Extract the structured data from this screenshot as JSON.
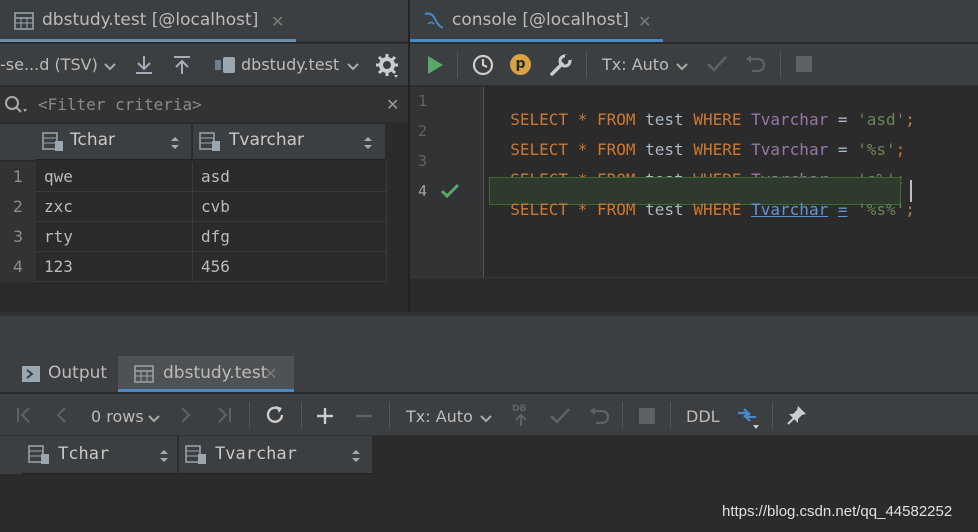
{
  "left_tab": {
    "title": "dbstudy.test [@localhost]",
    "close": "✕"
  },
  "right_tab": {
    "title": "console [@localhost]",
    "close": "✕"
  },
  "left_toolbar": {
    "export_format": "-se...d (TSV)",
    "datasource": "dbstudy.test"
  },
  "filter": {
    "placeholder": "<Filter criteria>",
    "clear": "✕"
  },
  "grid": {
    "columns": [
      "Tchar",
      "Tvarchar"
    ],
    "rows": [
      {
        "num": "1",
        "cells": [
          "qwe",
          "asd"
        ]
      },
      {
        "num": "2",
        "cells": [
          "zxc",
          "cvb"
        ]
      },
      {
        "num": "3",
        "cells": [
          "rty",
          "dfg"
        ]
      },
      {
        "num": "4",
        "cells": [
          "123",
          "456"
        ]
      }
    ]
  },
  "console_toolbar": {
    "tx_mode": "Tx: Auto",
    "p_badge": "p"
  },
  "editor": {
    "line_numbers": [
      "1",
      "2",
      "3",
      "4"
    ],
    "lines": [
      {
        "s": "SELECT",
        "star": "*",
        "from": "FROM",
        "table": "test",
        "where": "WHERE",
        "column": "Tvarchar",
        "eq": "=",
        "value": "'asd'",
        "semi": ";"
      },
      {
        "s": "SELECT",
        "star": "*",
        "from": "FROM",
        "table": "test",
        "where": "WHERE",
        "column": "Tvarchar",
        "eq": "=",
        "value": "'%s'",
        "semi": ";"
      },
      {
        "s": "SELECT",
        "star": "*",
        "from": "FROM",
        "table": "test",
        "where": "WHERE",
        "column": "Tvarchar",
        "eq": "=",
        "value": "'s%'",
        "semi": ";"
      },
      {
        "s": "SELECT",
        "star": "*",
        "from": "FROM",
        "table": "test",
        "where": "WHERE",
        "column": "Tvarchar",
        "eq": "=",
        "value": "'%s%'",
        "semi": ";"
      }
    ]
  },
  "bottom_tabs": {
    "output": "Output",
    "results": "dbstudy.test",
    "close": "✕"
  },
  "bottom_toolbar": {
    "rows": "0 rows",
    "tx_mode": "Tx: Auto",
    "ddl": "DDL",
    "db_badge": "DB"
  },
  "bottom_grid": {
    "columns": [
      "Tchar",
      "Tvarchar"
    ]
  },
  "watermark": "https://blog.csdn.net/qq_44582252",
  "colors": {
    "accent": "#4a88c7",
    "run_green": "#59a869",
    "keyword": "#cc7832",
    "string": "#6a8759",
    "column": "#9876aa"
  },
  "icons": [
    "table-icon",
    "console-icon",
    "download-icon",
    "upload-icon",
    "datasource-icon",
    "gear-icon",
    "search-icon",
    "run-icon",
    "history-icon",
    "p-badge-icon",
    "wrench-icon",
    "check-icon",
    "undo-icon",
    "stop-icon",
    "first-page-icon",
    "prev-page-icon",
    "next-page-icon",
    "last-page-icon",
    "refresh-icon",
    "add-row-icon",
    "remove-row-icon",
    "pin-icon",
    "compare-icon",
    "column-icon",
    "sort-icon",
    "output-icon"
  ]
}
